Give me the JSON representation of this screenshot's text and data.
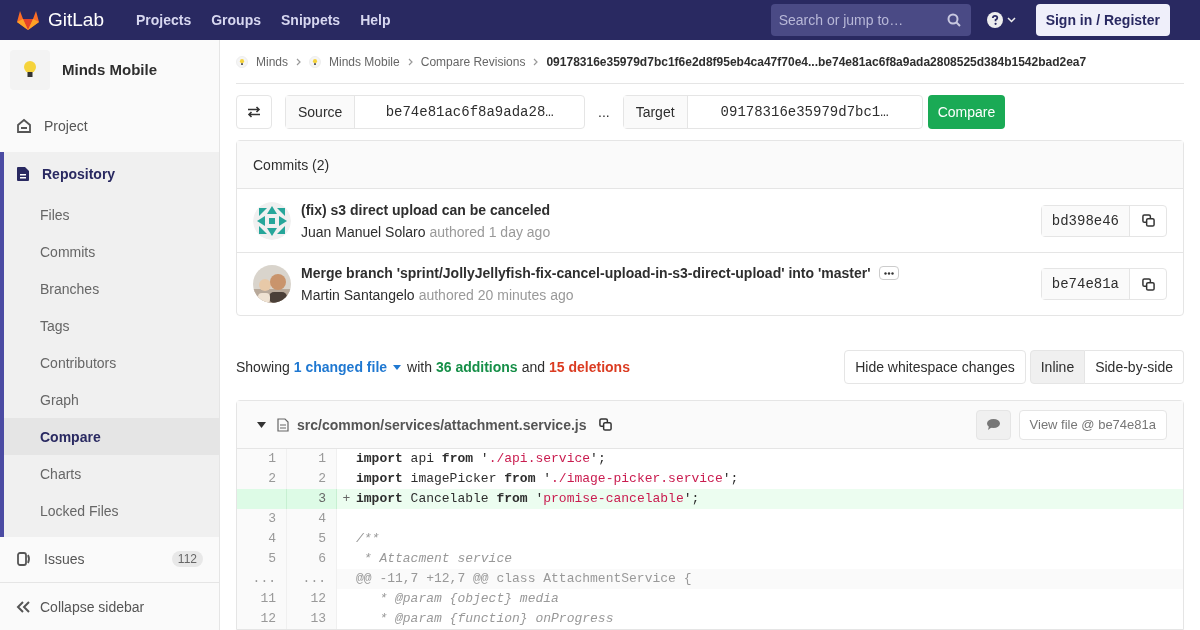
{
  "navbar": {
    "brand": "GitLab",
    "links": [
      "Projects",
      "Groups",
      "Snippets",
      "Help"
    ],
    "search": {
      "placeholder": "Search or jump to…"
    },
    "sign_in": "Sign in / Register"
  },
  "sidebar": {
    "project": "Minds Mobile",
    "items": [
      {
        "label": "Project",
        "kind": "top",
        "selected": false
      },
      {
        "label": "Repository",
        "kind": "section",
        "selected": true,
        "children": [
          {
            "label": "Files",
            "selected": false
          },
          {
            "label": "Commits",
            "selected": false
          },
          {
            "label": "Branches",
            "selected": false
          },
          {
            "label": "Tags",
            "selected": false
          },
          {
            "label": "Contributors",
            "selected": false
          },
          {
            "label": "Graph",
            "selected": false
          },
          {
            "label": "Compare",
            "selected": true
          },
          {
            "label": "Charts",
            "selected": false
          },
          {
            "label": "Locked Files",
            "selected": false
          }
        ]
      },
      {
        "label": "Issues",
        "kind": "top",
        "selected": false,
        "badge": "112"
      }
    ],
    "collapse": "Collapse sidebar"
  },
  "breadcrumbs": [
    "Minds",
    "Minds Mobile",
    "Compare Revisions",
    "09178316e35979d7bc1f6e2d8f95eb4ca47f70e4...be74e81ac6f8a9ada2808525d384b1542bad2ea7"
  ],
  "compare": {
    "source_label": "Source",
    "source": "be74e81ac6f8a9ada28…",
    "separator": "...",
    "target_label": "Target",
    "target": "09178316e35979d7bc1…",
    "button": "Compare"
  },
  "commits": {
    "title": "Commits (2)",
    "items": [
      {
        "title": "(fix) s3 direct upload can be canceled",
        "author": "Juan Manuel Solaro",
        "meta": "authored 1 day ago",
        "sha": "bd398e46",
        "avatar": {
          "kind": "identicon"
        },
        "has_more": false
      },
      {
        "title": "Merge branch 'sprint/JollyJellyfish-fix-cancel-upload-in-s3-direct-upload' into 'master'",
        "author": "Martin Santangelo",
        "meta": "authored 20 minutes ago",
        "sha": "be74e81a",
        "has_more": true
      }
    ]
  },
  "summary": {
    "showing": "Showing",
    "changed": "1 changed file",
    "with": "with",
    "additions": "36 additions",
    "and": "and",
    "deletions": "15 deletions"
  },
  "view_buttons": [
    {
      "label": "Hide whitespace changes",
      "kind": "toggle",
      "selected": false
    },
    {
      "label": "Inline",
      "kind": "mode",
      "selected": true
    },
    {
      "label": "Side-by-side",
      "kind": "mode",
      "selected": false
    }
  ],
  "file": {
    "path": "src/common/services/attachment.service.js",
    "view_file": "View file @ be74e81a",
    "expanded": true,
    "lines": [
      {
        "kind": "context",
        "old": "1",
        "new": "1",
        "tokens": [
          {
            "kind": "kw",
            "text": "import"
          },
          {
            "kind": "plain",
            "text": " api "
          },
          {
            "kind": "kw",
            "text": "from"
          },
          {
            "kind": "plain",
            "text": " '"
          },
          {
            "kind": "str",
            "text": "./api.service"
          },
          {
            "kind": "plain",
            "text": "';"
          }
        ]
      },
      {
        "kind": "context",
        "old": "2",
        "new": "2",
        "tokens": [
          {
            "kind": "kw",
            "text": "import"
          },
          {
            "kind": "plain",
            "text": " imagePicker "
          },
          {
            "kind": "kw",
            "text": "from"
          },
          {
            "kind": "plain",
            "text": " '"
          },
          {
            "kind": "str",
            "text": "./image-picker.service"
          },
          {
            "kind": "plain",
            "text": "';"
          }
        ]
      },
      {
        "kind": "added",
        "new": "3",
        "sign": "+",
        "tokens": [
          {
            "kind": "kw",
            "text": "import"
          },
          {
            "kind": "plain",
            "text": " Cancelable "
          },
          {
            "kind": "kw",
            "text": "from"
          },
          {
            "kind": "plain",
            "text": " '"
          },
          {
            "kind": "str",
            "text": "promise-cancelable"
          },
          {
            "kind": "plain",
            "text": "';"
          }
        ]
      },
      {
        "kind": "context",
        "old": "3",
        "new": "4"
      },
      {
        "kind": "context",
        "old": "4",
        "new": "5",
        "tokens": [
          {
            "kind": "comment",
            "text": "/**"
          }
        ]
      },
      {
        "kind": "context",
        "old": "5",
        "new": "6",
        "tokens": [
          {
            "kind": "comment",
            "text": " * Attacment service"
          }
        ]
      },
      {
        "kind": "hunk",
        "old": "...",
        "new": "...",
        "tokens": [
          {
            "kind": "hunk",
            "text": "@@ -11,7 +12,7 @@ class AttachmentService {"
          }
        ]
      },
      {
        "kind": "context",
        "old": "11",
        "new": "12",
        "tokens": [
          {
            "kind": "comment",
            "text": "   * @param {object} media"
          }
        ]
      },
      {
        "kind": "context",
        "old": "12",
        "new": "13",
        "tokens": [
          {
            "kind": "comment",
            "text": "   * @param {function} onProgress"
          }
        ]
      }
    ]
  }
}
